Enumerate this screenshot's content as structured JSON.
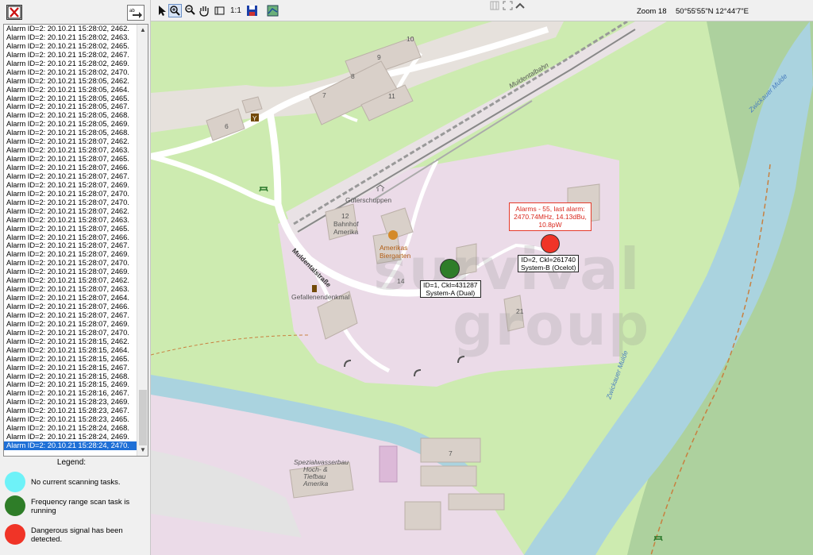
{
  "alarm_list": {
    "rows": [
      "Alarm ID=2: 20.10.21 15:28:02, 2462.",
      "Alarm ID=2: 20.10.21 15:28:02, 2463.",
      "Alarm ID=2: 20.10.21 15:28:02, 2465.",
      "Alarm ID=2: 20.10.21 15:28:02, 2467.",
      "Alarm ID=2: 20.10.21 15:28:02, 2469.",
      "Alarm ID=2: 20.10.21 15:28:02, 2470.",
      "Alarm ID=2: 20.10.21 15:28:05, 2462.",
      "Alarm ID=2: 20.10.21 15:28:05, 2464.",
      "Alarm ID=2: 20.10.21 15:28:05, 2465.",
      "Alarm ID=2: 20.10.21 15:28:05, 2467.",
      "Alarm ID=2: 20.10.21 15:28:05, 2468.",
      "Alarm ID=2: 20.10.21 15:28:05, 2469.",
      "Alarm ID=2: 20.10.21 15:28:05, 2468.",
      "Alarm ID=2: 20.10.21 15:28:07, 2462.",
      "Alarm ID=2: 20.10.21 15:28:07, 2463.",
      "Alarm ID=2: 20.10.21 15:28:07, 2465.",
      "Alarm ID=2: 20.10.21 15:28:07, 2466.",
      "Alarm ID=2: 20.10.21 15:28:07, 2467.",
      "Alarm ID=2: 20.10.21 15:28:07, 2469.",
      "Alarm ID=2: 20.10.21 15:28:07, 2470.",
      "Alarm ID=2: 20.10.21 15:28:07, 2470.",
      "Alarm ID=2: 20.10.21 15:28:07, 2462.",
      "Alarm ID=2: 20.10.21 15:28:07, 2463.",
      "Alarm ID=2: 20.10.21 15:28:07, 2465.",
      "Alarm ID=2: 20.10.21 15:28:07, 2466.",
      "Alarm ID=2: 20.10.21 15:28:07, 2467.",
      "Alarm ID=2: 20.10.21 15:28:07, 2469.",
      "Alarm ID=2: 20.10.21 15:28:07, 2470.",
      "Alarm ID=2: 20.10.21 15:28:07, 2469.",
      "Alarm ID=2: 20.10.21 15:28:07, 2462.",
      "Alarm ID=2: 20.10.21 15:28:07, 2463.",
      "Alarm ID=2: 20.10.21 15:28:07, 2464.",
      "Alarm ID=2: 20.10.21 15:28:07, 2466.",
      "Alarm ID=2: 20.10.21 15:28:07, 2467.",
      "Alarm ID=2: 20.10.21 15:28:07, 2469.",
      "Alarm ID=2: 20.10.21 15:28:07, 2470.",
      "Alarm ID=2: 20.10.21 15:28:15, 2462.",
      "Alarm ID=2: 20.10.21 15:28:15, 2464.",
      "Alarm ID=2: 20.10.21 15:28:15, 2465.",
      "Alarm ID=2: 20.10.21 15:28:15, 2467.",
      "Alarm ID=2: 20.10.21 15:28:15, 2468.",
      "Alarm ID=2: 20.10.21 15:28:15, 2469.",
      "Alarm ID=2: 20.10.21 15:28:16, 2467.",
      "Alarm ID=2: 20.10.21 15:28:23, 2469.",
      "Alarm ID=2: 20.10.21 15:28:23, 2467.",
      "Alarm ID=2: 20.10.21 15:28:23, 2465.",
      "Alarm ID=2: 20.10.21 15:28:24, 2468.",
      "Alarm ID=2: 20.10.21 15:28:24, 2469.",
      "Alarm ID=2: 20.10.21 15:28:24, 2470."
    ],
    "selected_index": 48
  },
  "legend": {
    "title": "Legend:",
    "items": [
      {
        "text": "No current scanning tasks.",
        "color": "#6ef2f8"
      },
      {
        "text": "Frequency range scan task is running",
        "color": "#2e7d28"
      },
      {
        "text": "Dangerous signal has been detected.",
        "color": "#f03427"
      }
    ]
  },
  "toolbar": {
    "tools": [
      "arrow-pointer",
      "zoom-in",
      "zoom-out",
      "pan-hand",
      "zoom-rectangle",
      "save",
      "map-layers"
    ],
    "scale_label": "1:1",
    "zoom_label": "Zoom 18",
    "coordinates": "50°55'55\"N 12°44'7\"E"
  },
  "map": {
    "street_labels": {
      "mulde": "Muldentalbahn",
      "muldentalstrasse": "Muldentalstraße",
      "gueterschuppen": "Güterschuppen",
      "bahnhof_1": "Bahnhof",
      "bahnhof_2": "Amerika",
      "biergarten_1": "Amerikas",
      "biergarten_2": "Biergarten",
      "denkmal": "Gefallenendenkmal",
      "spezialwasserbau_1": "Spezialwasserbau",
      "spezialwasserbau_2": "Hoch- &",
      "spezialwasserbau_3": "Tiefbau",
      "spezialwasserbau_4": "Amerika",
      "zwickauer_mulde_1": "Zwickauer Mulde",
      "zwickauer_mulde_2": "Zwickauer Mulde"
    },
    "house_numbers": [
      "10",
      "9",
      "8",
      "7",
      "11",
      "6",
      "12",
      "14",
      "21",
      "7"
    ],
    "colors": {
      "water": "#aad3df",
      "forest": "#add19e",
      "grass": "#cdebb0",
      "industrial": "#ebdbe8",
      "rail": "#999999"
    }
  },
  "markers": [
    {
      "id": "system-a",
      "label_1": "ID=1, Ckl=431287",
      "label_2": "System-A (Dual)",
      "color": "#2e7d28"
    },
    {
      "id": "system-b",
      "label_1": "ID=2, Ckl=261740",
      "label_2": "System-B (Ocelot)",
      "color": "#f03427",
      "alert_1": "Alarms - 55, last alarm:",
      "alert_2": "2470.74MHz, 14.13dBu,",
      "alert_3": "10.8pW"
    }
  ],
  "watermark": {
    "line_1": "survival",
    "line_2": "group"
  }
}
